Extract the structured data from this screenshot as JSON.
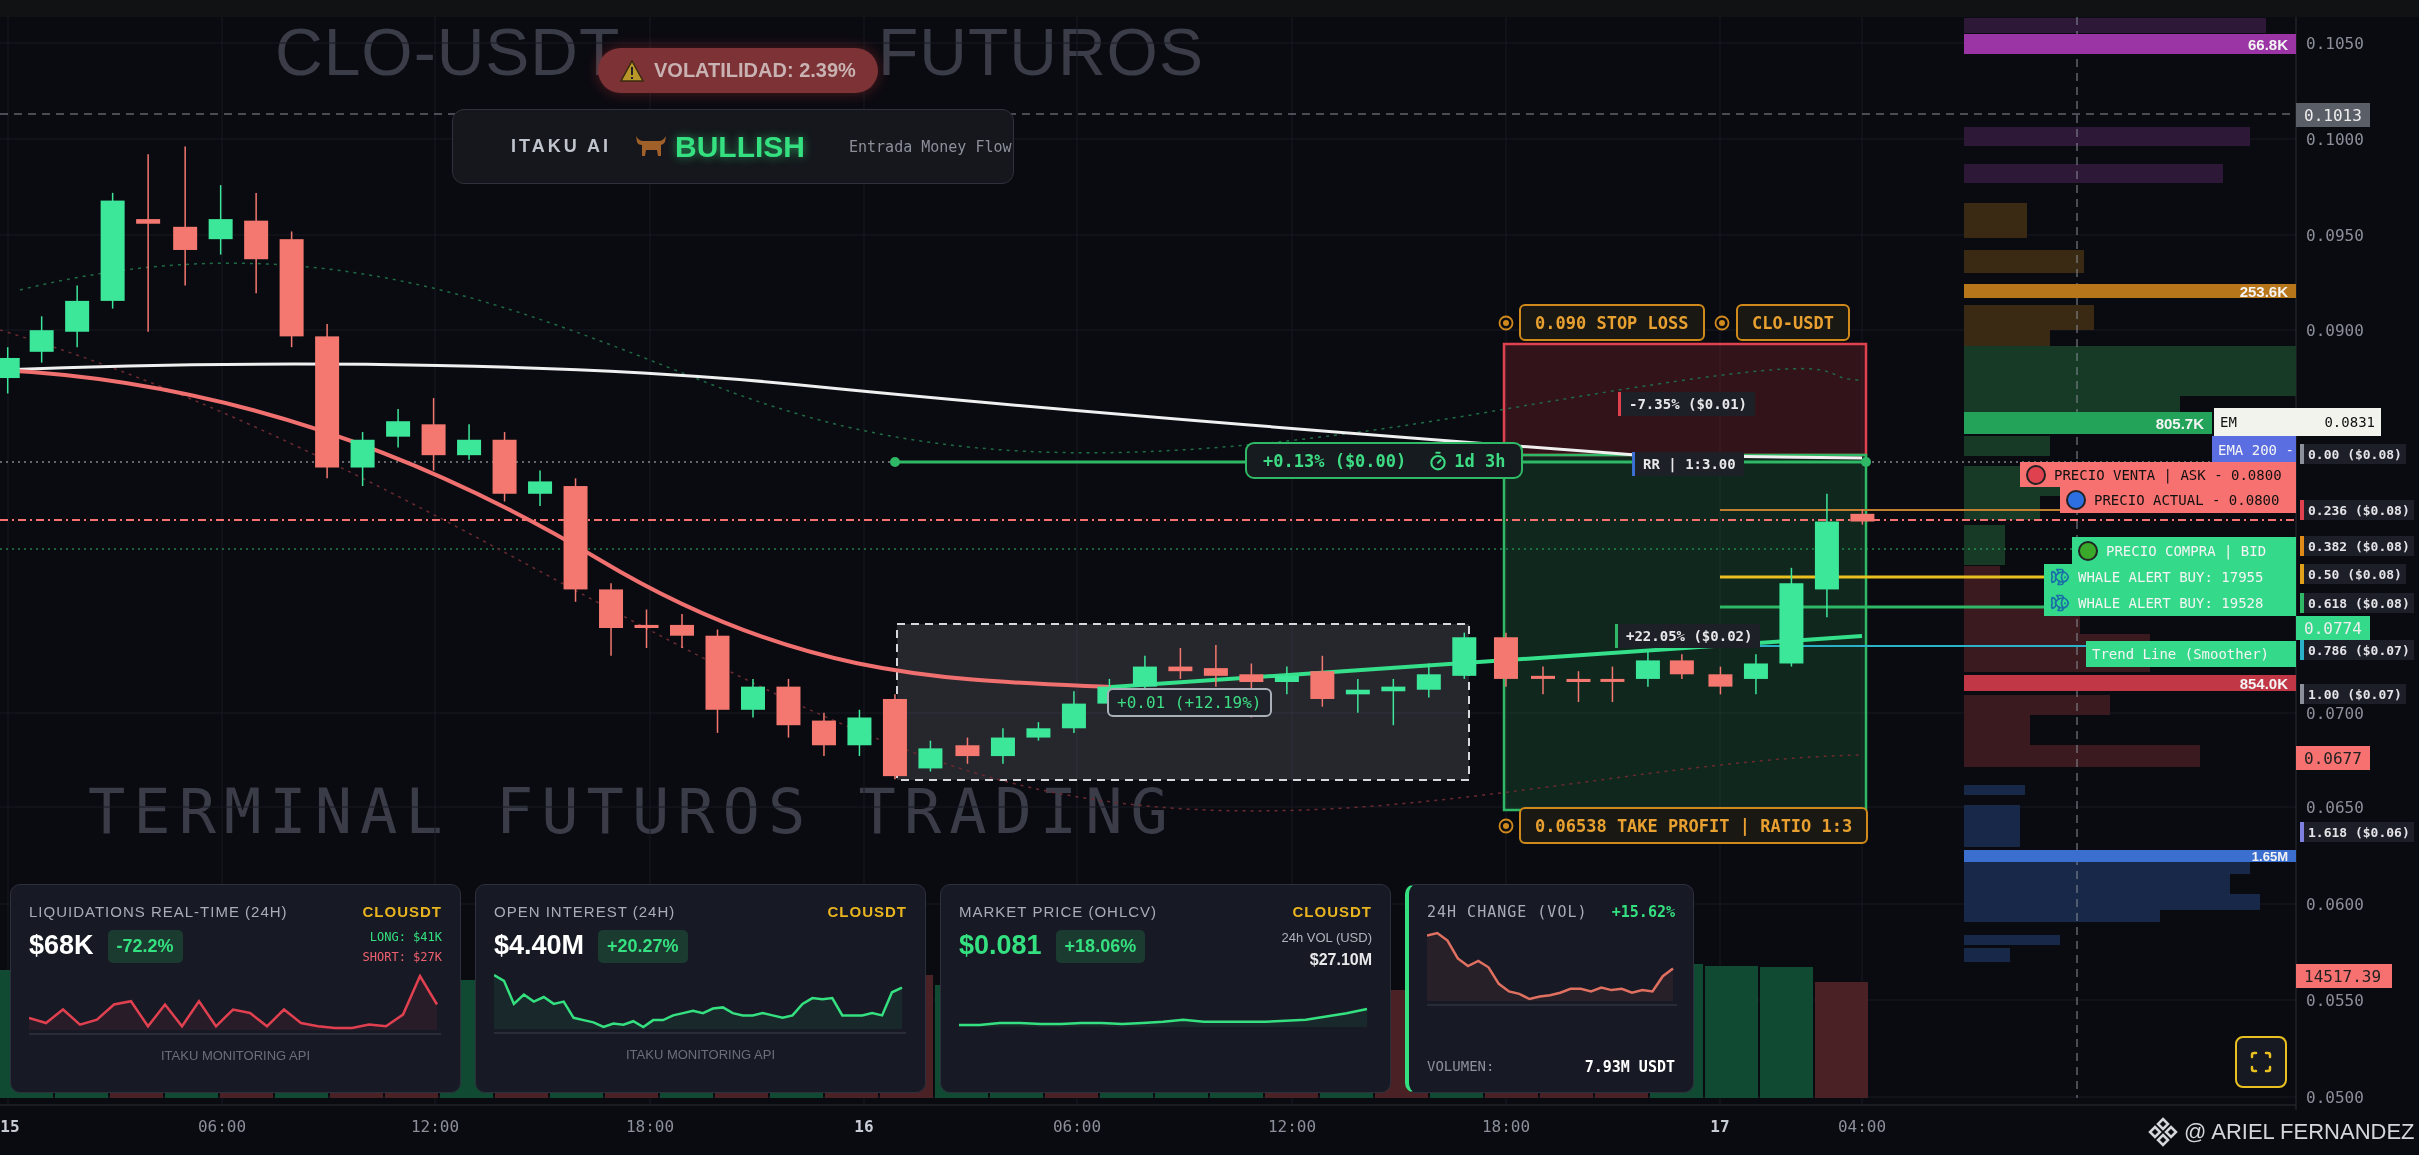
{
  "chart_title": [
    "CLO-USDT",
    "FUTUROS"
  ],
  "background_text": "TERMINAL FUTUROS TRADING",
  "volatility_badge": "VOLATILIDAD: 2.39%",
  "signal_panel": {
    "source": "ITAKU AI",
    "sentiment": "BULLISH",
    "note": "Entrada Money Flow"
  },
  "trade_setup": {
    "stop_loss": "0.090 STOP LOSS",
    "symbol": "CLO-USDT",
    "loss_pct": "-7.35% ($0.01)",
    "risk_reward": "RR | 1:3.00",
    "gain_pct": "+22.05% ($0.02)",
    "take_profit": "0.06538 TAKE PROFIT | RATIO 1:3"
  },
  "measure": {
    "change": "+0.13% ($0.00)",
    "duration": "1d 3h"
  },
  "range_label": "+0.01 (+12.19%)",
  "price_axis": {
    "ticks": [
      "0.1050",
      "0.1000",
      "0.0950",
      "0.0900",
      "0.0700",
      "0.0650",
      "0.0600",
      "0.0550",
      "0.0500"
    ]
  },
  "time_axis": [
    {
      "label": "15",
      "kind": "day"
    },
    {
      "label": "06:00",
      "kind": "time"
    },
    {
      "label": "12:00",
      "kind": "time"
    },
    {
      "label": "18:00",
      "kind": "time"
    },
    {
      "label": "16",
      "kind": "day"
    },
    {
      "label": "06:00",
      "kind": "time"
    },
    {
      "label": "12:00",
      "kind": "time"
    },
    {
      "label": "18:00",
      "kind": "time"
    },
    {
      "label": "17",
      "kind": "day"
    },
    {
      "label": "04:00",
      "kind": "time"
    }
  ],
  "volume_profile_labels": [
    {
      "text": "66.8K",
      "color": "#9b35a5"
    },
    {
      "text": "253.6K",
      "color": "#b8761a"
    },
    {
      "text": "805.7K",
      "color": "#23a35a"
    },
    {
      "text": "854.0K",
      "color": "#c23746"
    },
    {
      "text": "1.65M",
      "color": "#3a6fd0"
    }
  ],
  "indicator_tags": [
    {
      "kind": "ema",
      "text": "EM",
      "value": "0.0831",
      "color": "#f3f3ee"
    },
    {
      "kind": "ema",
      "text": "EMA 200 -",
      "color": "#5b6ee1"
    },
    {
      "kind": "ask",
      "text": "PRECIO VENTA | ASK - 0.0800",
      "color": "#f87171"
    },
    {
      "kind": "current",
      "text": "PRECIO ACTUAL - 0.0800",
      "color": "#f87171"
    },
    {
      "kind": "bid",
      "text": "PRECIO COMPRA | BID",
      "color": "#34d98a"
    },
    {
      "kind": "whale",
      "text": "WHALE ALERT BUY: 17955",
      "color": "#34d98a"
    },
    {
      "kind": "whale",
      "text": "WHALE ALERT BUY: 19528",
      "color": "#34d98a"
    },
    {
      "kind": "trend",
      "text": "Trend Line (Smoother)",
      "color": "#34d98a"
    }
  ],
  "fib_levels": [
    {
      "text": "0.00 ($0.08)",
      "color": "#8a8f99"
    },
    {
      "text": "0.236 ($0.08)",
      "color": "#e0414f"
    },
    {
      "text": "0.382 ($0.08)",
      "color": "#e08a1a"
    },
    {
      "text": "0.50 ($0.08)",
      "color": "#e0a01a"
    },
    {
      "text": "0.618 ($0.08)",
      "color": "#2fb865"
    },
    {
      "text": "0.786 ($0.07)",
      "color": "#2ab3c8"
    },
    {
      "text": "1.00 ($0.07)",
      "color": "#8a8f99"
    },
    {
      "text": "1.618 ($0.06)",
      "color": "#7f7fe0"
    }
  ],
  "price_tags": [
    {
      "text": "0.1013",
      "color": "#5a5e66"
    },
    {
      "text": "0.0774",
      "color": "#34d98a"
    },
    {
      "text": "0.0677",
      "color": "#f87171"
    },
    {
      "text": "14517.39",
      "color": "#f87171"
    }
  ],
  "cards": [
    {
      "kind": "liquidations",
      "title": "LIQUIDATIONS REAL-TIME (24H)",
      "symbol": "CLOUSDT",
      "value": "$68K",
      "change": "-72.2%",
      "long": "LONG: $41K",
      "short": "SHORT: $27K",
      "footer": "ITAKU MONITORING API"
    },
    {
      "kind": "open_interest",
      "title": "OPEN INTEREST (24H)",
      "symbol": "CLOUSDT",
      "value": "$4.40M",
      "change": "+20.27%",
      "footer": "ITAKU MONITORING API"
    },
    {
      "kind": "market_price",
      "title": "MARKET PRICE (OHLCV)",
      "symbol": "CLOUSDT",
      "value": "$0.081",
      "change": "+18.06%",
      "volume_label": "24h VOL (USD)",
      "volume": "$27.10M"
    },
    {
      "kind": "change",
      "title": "24H CHANGE (VOL)",
      "change": "+15.62%",
      "volume_label": "VOLUMEN:",
      "volume": "7.93M USDT"
    }
  ],
  "credit": "@ ARIEL FERNANDEZ"
}
